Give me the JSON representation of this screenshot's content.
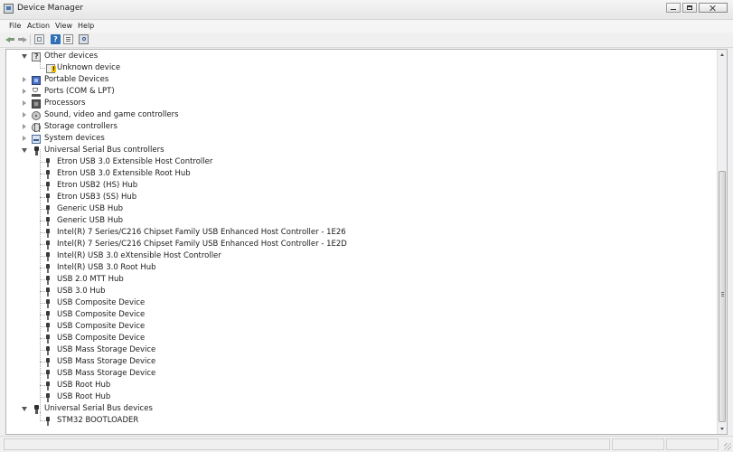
{
  "window": {
    "title": "Device Manager"
  },
  "menu": {
    "items": [
      "File",
      "Action",
      "View",
      "Help"
    ]
  },
  "toolbar": {
    "buttons": [
      {
        "name": "back",
        "icon": "back-arrow-icon"
      },
      {
        "name": "forward",
        "icon": "forward-arrow-icon"
      },
      {
        "name": "show-hide-console-tree",
        "icon": "console-tree-icon"
      },
      {
        "name": "help",
        "icon": "help-icon",
        "glyph": "?"
      },
      {
        "name": "properties",
        "icon": "properties-icon"
      },
      {
        "name": "scan-for-hardware-changes",
        "icon": "scan-hardware-icon"
      }
    ]
  },
  "tree": {
    "rows": [
      {
        "label": "Other devices",
        "level": 0,
        "state": "expanded",
        "icon": "other-devices-icon"
      },
      {
        "label": "Unknown device",
        "level": 1,
        "icon": "unknown-device-warning-icon"
      },
      {
        "label": "Portable Devices",
        "level": 0,
        "state": "collapsed",
        "icon": "portable-devices-icon"
      },
      {
        "label": "Ports (COM & LPT)",
        "level": 0,
        "state": "collapsed",
        "icon": "ports-icon"
      },
      {
        "label": "Processors",
        "level": 0,
        "state": "collapsed",
        "icon": "processor-icon"
      },
      {
        "label": "Sound, video and game controllers",
        "level": 0,
        "state": "collapsed",
        "icon": "sound-icon"
      },
      {
        "label": "Storage controllers",
        "level": 0,
        "state": "collapsed",
        "icon": "storage-controller-icon"
      },
      {
        "label": "System devices",
        "level": 0,
        "state": "collapsed",
        "icon": "system-devices-icon"
      },
      {
        "label": "Universal Serial Bus controllers",
        "level": 0,
        "state": "expanded",
        "icon": "usb-controllers-icon"
      },
      {
        "label": "Etron USB 3.0 Extensible Host Controller",
        "level": 1,
        "icon": "usb-device-icon"
      },
      {
        "label": "Etron USB 3.0 Extensible Root Hub",
        "level": 1,
        "icon": "usb-device-icon"
      },
      {
        "label": "Etron USB2 (HS) Hub",
        "level": 1,
        "icon": "usb-device-icon"
      },
      {
        "label": "Etron USB3 (SS) Hub",
        "level": 1,
        "icon": "usb-device-icon"
      },
      {
        "label": "Generic USB Hub",
        "level": 1,
        "icon": "usb-device-icon"
      },
      {
        "label": "Generic USB Hub",
        "level": 1,
        "icon": "usb-device-icon"
      },
      {
        "label": "Intel(R) 7 Series/C216 Chipset Family USB Enhanced Host Controller - 1E26",
        "level": 1,
        "icon": "usb-device-icon"
      },
      {
        "label": "Intel(R) 7 Series/C216 Chipset Family USB Enhanced Host Controller - 1E2D",
        "level": 1,
        "icon": "usb-device-icon"
      },
      {
        "label": "Intel(R) USB 3.0 eXtensible Host Controller",
        "level": 1,
        "icon": "usb-device-icon"
      },
      {
        "label": "Intel(R) USB 3.0 Root Hub",
        "level": 1,
        "icon": "usb-device-icon"
      },
      {
        "label": "USB 2.0 MTT Hub",
        "level": 1,
        "icon": "usb-device-icon"
      },
      {
        "label": "USB 3.0 Hub",
        "level": 1,
        "icon": "usb-device-icon"
      },
      {
        "label": "USB Composite Device",
        "level": 1,
        "icon": "usb-device-icon"
      },
      {
        "label": "USB Composite Device",
        "level": 1,
        "icon": "usb-device-icon"
      },
      {
        "label": "USB Composite Device",
        "level": 1,
        "icon": "usb-device-icon"
      },
      {
        "label": "USB Composite Device",
        "level": 1,
        "icon": "usb-device-icon"
      },
      {
        "label": "USB Mass Storage Device",
        "level": 1,
        "icon": "usb-device-icon"
      },
      {
        "label": "USB Mass Storage Device",
        "level": 1,
        "icon": "usb-device-icon"
      },
      {
        "label": "USB Mass Storage Device",
        "level": 1,
        "icon": "usb-device-icon"
      },
      {
        "label": "USB Root Hub",
        "level": 1,
        "icon": "usb-device-icon"
      },
      {
        "label": "USB Root Hub",
        "level": 1,
        "icon": "usb-device-icon"
      },
      {
        "label": "Universal Serial Bus devices",
        "level": 0,
        "state": "expanded",
        "icon": "usb-devices-icon"
      },
      {
        "label": "STM32  BOOTLOADER",
        "level": 1,
        "icon": "usb-device-icon"
      }
    ]
  },
  "colors": {
    "window_bg": "#f0f0f0",
    "tree_bg": "#ffffff",
    "text": "#1a1a1a",
    "help_icon": "#2f6fb5",
    "warning": "#f2c200"
  }
}
